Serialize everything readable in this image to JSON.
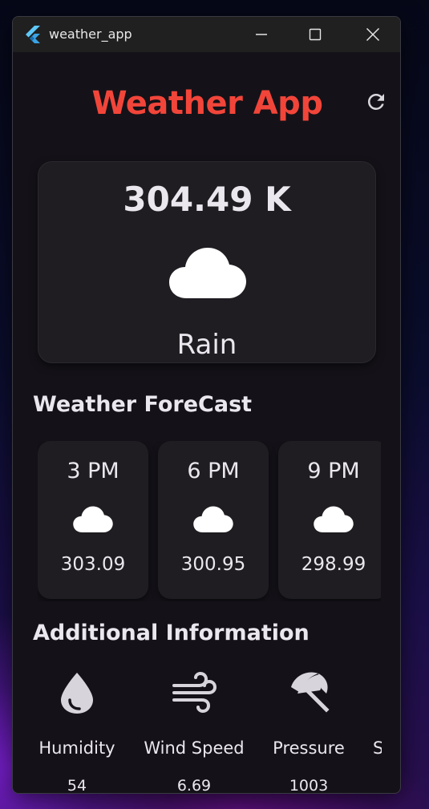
{
  "window": {
    "title": "weather_app"
  },
  "app": {
    "title": "Weather App",
    "title_color": "#f2453a"
  },
  "current": {
    "temperature": "304.49 K",
    "condition": "Rain",
    "icon": "cloud-icon"
  },
  "forecast": {
    "heading": "Weather ForeCast",
    "items": [
      {
        "time": "3 PM",
        "temp": "303.09",
        "icon": "cloud-icon"
      },
      {
        "time": "6 PM",
        "temp": "300.95",
        "icon": "cloud-icon"
      },
      {
        "time": "9 PM",
        "temp": "298.99",
        "icon": "cloud-icon"
      }
    ]
  },
  "additional": {
    "heading": "Additional Information",
    "items": [
      {
        "label": "Humidity",
        "value": "54",
        "icon": "water-drop-icon"
      },
      {
        "label": "Wind Speed",
        "value": "6.69",
        "icon": "air-icon"
      },
      {
        "label": "Pressure",
        "value": "1003",
        "icon": "beach-umbrella-icon"
      },
      {
        "label": "S",
        "value": "",
        "icon": ""
      }
    ]
  }
}
